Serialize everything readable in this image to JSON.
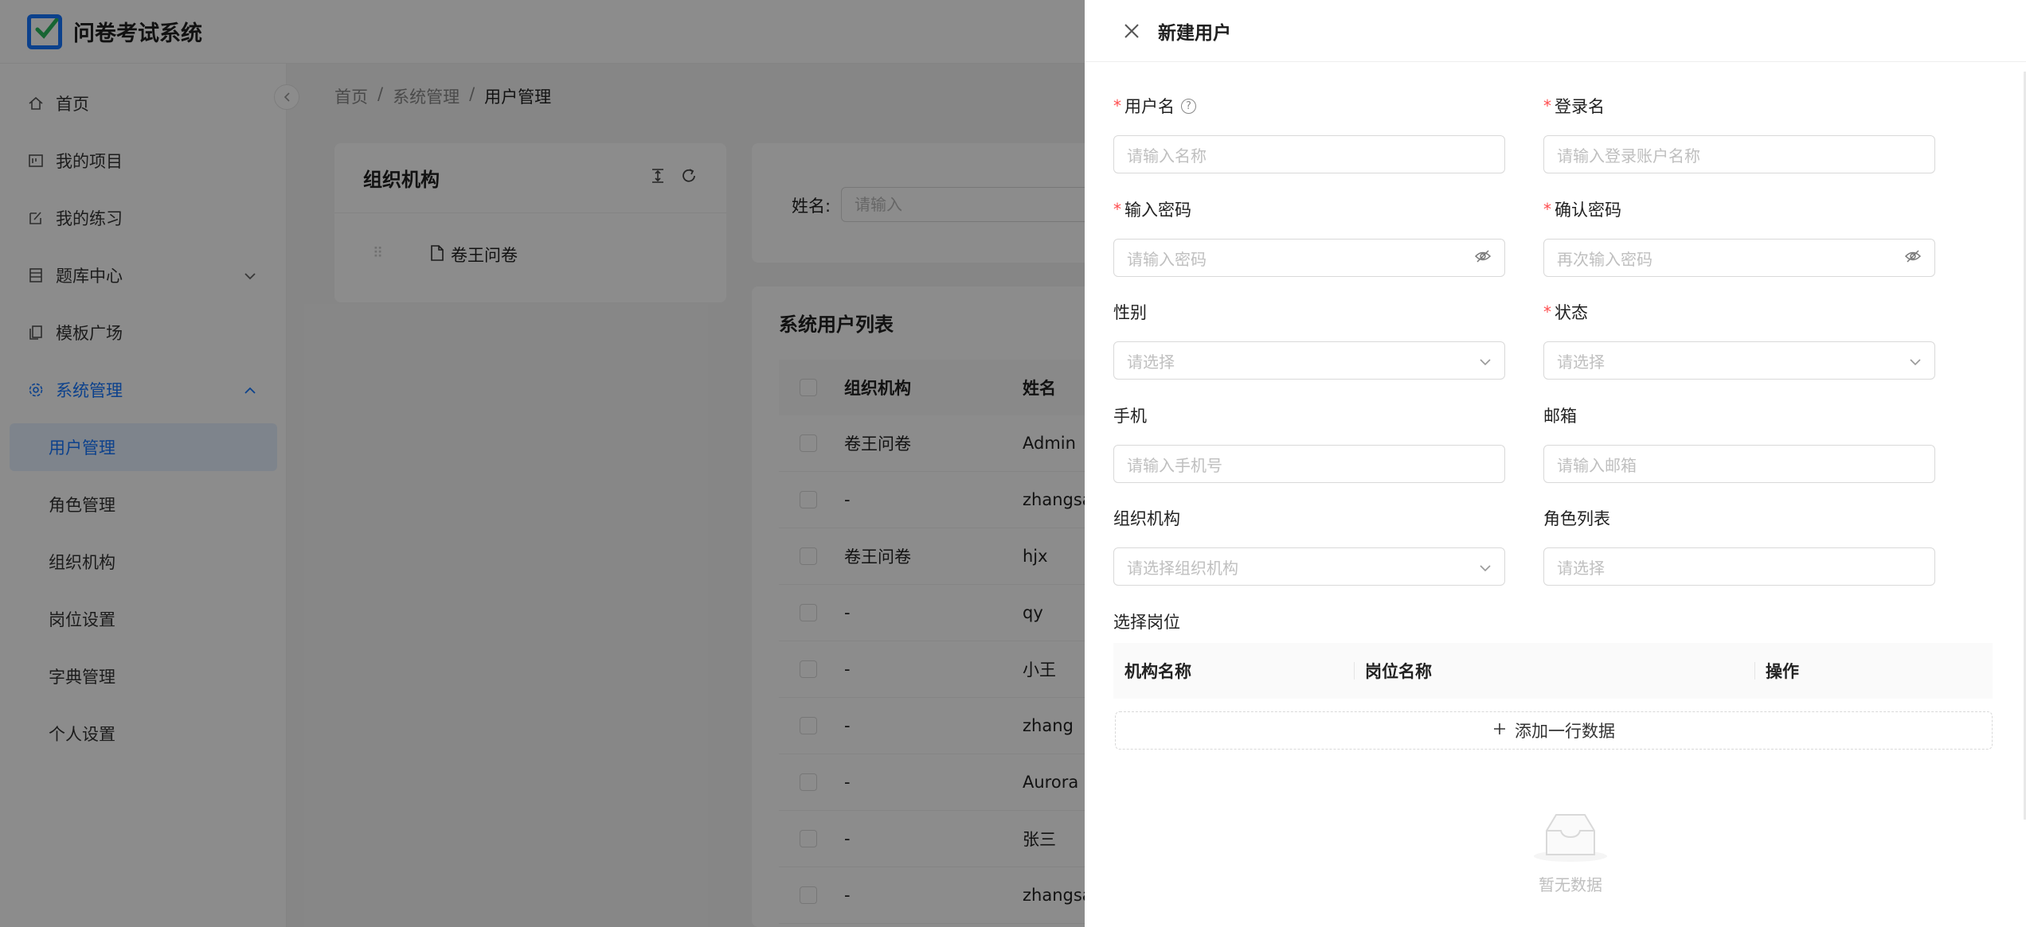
{
  "app": {
    "title": "问卷考试系统",
    "accent": "#1677ff"
  },
  "sidebar": {
    "items": [
      {
        "label": "首页",
        "icon": "home-icon"
      },
      {
        "label": "我的项目",
        "icon": "project-icon"
      },
      {
        "label": "我的练习",
        "icon": "edit-icon"
      },
      {
        "label": "题库中心",
        "icon": "database-icon"
      },
      {
        "label": "模板广场",
        "icon": "template-icon"
      },
      {
        "label": "系统管理",
        "icon": "gear-icon"
      }
    ],
    "submenu": [
      "用户管理",
      "角色管理",
      "组织机构",
      "岗位设置",
      "字典管理",
      "个人设置"
    ]
  },
  "breadcrumb": [
    "首页",
    "系统管理",
    "用户管理"
  ],
  "org_panel": {
    "title": "组织机构",
    "tree_root": "卷王问卷"
  },
  "search": {
    "label": "姓名:",
    "placeholder": "请输入"
  },
  "user_list": {
    "title": "系统用户列表",
    "columns": [
      "组织机构",
      "姓名"
    ],
    "rows": [
      {
        "org": "卷王问卷",
        "name": "Admin"
      },
      {
        "org": "-",
        "name": "zhangsa"
      },
      {
        "org": "卷王问卷",
        "name": "hjx"
      },
      {
        "org": "-",
        "name": "qy"
      },
      {
        "org": "-",
        "name": "小王"
      },
      {
        "org": "-",
        "name": "zhang"
      },
      {
        "org": "-",
        "name": "Aurora"
      },
      {
        "org": "-",
        "name": "张三"
      },
      {
        "org": "-",
        "name": "zhangsa"
      }
    ]
  },
  "drawer": {
    "title": "新建用户",
    "fields": {
      "username": {
        "label": "用户名",
        "placeholder": "请输入名称"
      },
      "login": {
        "label": "登录名",
        "placeholder": "请输入登录账户名称"
      },
      "password": {
        "label": "输入密码",
        "placeholder": "请输入密码"
      },
      "confirm": {
        "label": "确认密码",
        "placeholder": "再次输入密码"
      },
      "gender": {
        "label": "性别",
        "placeholder": "请选择"
      },
      "status": {
        "label": "状态",
        "placeholder": "请选择"
      },
      "phone": {
        "label": "手机",
        "placeholder": "请输入手机号"
      },
      "email": {
        "label": "邮箱",
        "placeholder": "请输入邮箱"
      },
      "org": {
        "label": "组织机构",
        "placeholder": "请选择组织机构"
      },
      "roles": {
        "label": "角色列表",
        "placeholder": "请选择"
      }
    },
    "positions": {
      "label": "选择岗位",
      "columns": [
        "机构名称",
        "岗位名称",
        "操作"
      ],
      "add_label": "添加一行数据",
      "empty_text": "暂无数据"
    }
  }
}
